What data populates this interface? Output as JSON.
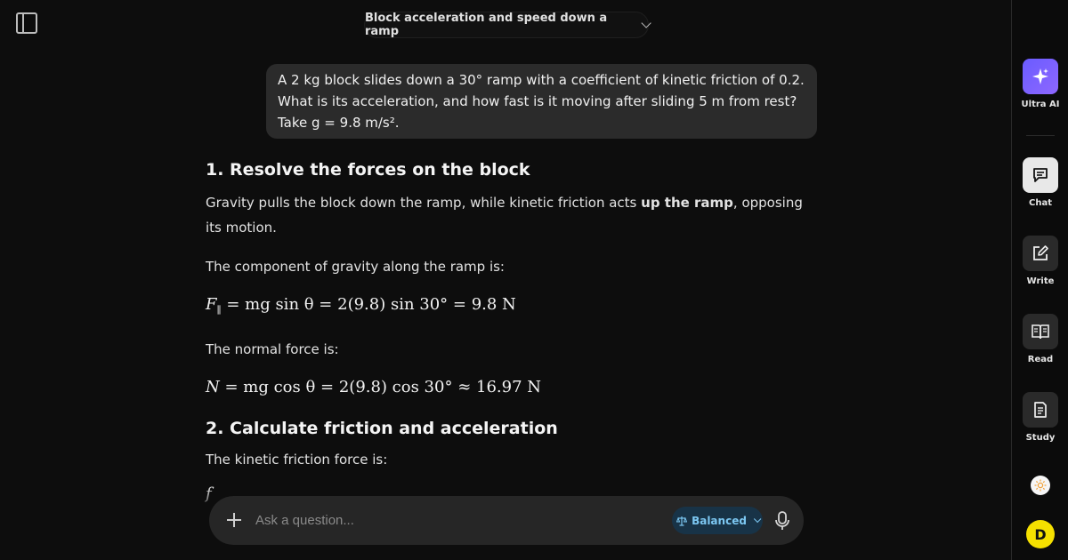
{
  "header": {
    "title": "Block acceleration and speed down a ramp"
  },
  "user_message": {
    "text": "A 2 kg block slides down a 30° ramp with a coefficient of kinetic friction of 0.2. What is its acceleration, and how fast is it moving after sliding 5 m from rest? Take g = 9.8 m/s²."
  },
  "answer": {
    "heading1": "1. Resolve the forces on the block",
    "p1_start": "Gravity pulls the block down the ramp, while kinetic friction acts ",
    "p1_bold": "up the ramp",
    "p1_end": ", opposing its motion.",
    "p2": "The component of gravity along the ramp is:",
    "eq1": "= mg sin θ = 2(9.8) sin 30° = 9.8 N",
    "eq1_lhs": "F",
    "eq1_sub": "∥",
    "p3": "The normal force is:",
    "eq2_lhs": "N",
    "eq2": "= mg cos θ = 2(9.8) cos 30° ≈ 16.97 N",
    "heading2": "2. Calculate friction and acceleration",
    "p4": "The kinetic friction force is:",
    "eq3_partial": "f"
  },
  "composer": {
    "placeholder": "Ask a question...",
    "mode_label": "Balanced",
    "mode_icon": "balance-scale-icon"
  },
  "rail": {
    "items": [
      {
        "label": "Ultra AI",
        "icon": "sparkle-icon"
      },
      {
        "label": "Chat",
        "icon": "chat-bubble-icon"
      },
      {
        "label": "Write",
        "icon": "edit-icon"
      },
      {
        "label": "Read",
        "icon": "book-icon"
      },
      {
        "label": "Study",
        "icon": "document-icon"
      }
    ]
  },
  "avatar": {
    "initial": "D"
  },
  "colors": {
    "background": "#0d0d0d",
    "bubble": "#2b2b2b",
    "accent_mode": "#7cc7f2",
    "ultra_gradient": "#6a5cff",
    "avatar": "#f5e000"
  }
}
